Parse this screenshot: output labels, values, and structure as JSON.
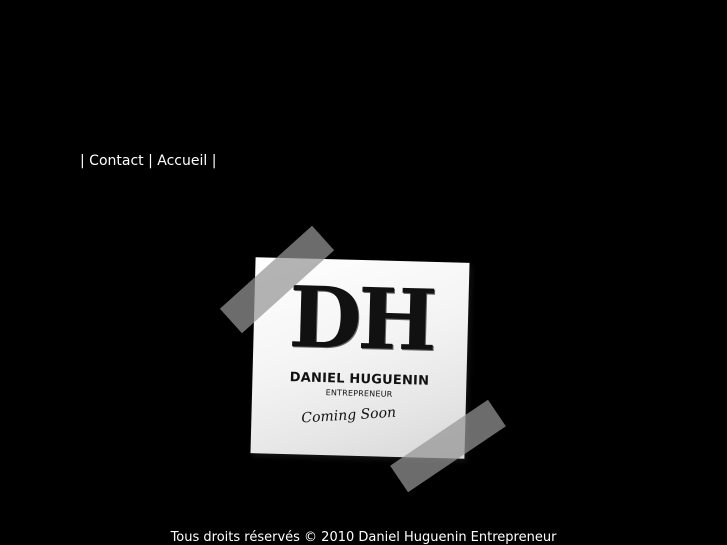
{
  "nav": {
    "separator": "|",
    "links": [
      {
        "label": "Contact"
      },
      {
        "label": "Accueil"
      }
    ]
  },
  "logo": {
    "monogram": "DH",
    "name": "DANIEL HUGUENIN",
    "subtitle": "ENTREPRENEUR",
    "tagline": "Coming Soon"
  },
  "footer": {
    "text": "Tous droits réservés © 2010 Daniel Huguenin Entrepreneur"
  },
  "colors": {
    "background": "#000000",
    "text": "#ffffff",
    "note": "#f2f2f2",
    "tape": "#969696"
  }
}
